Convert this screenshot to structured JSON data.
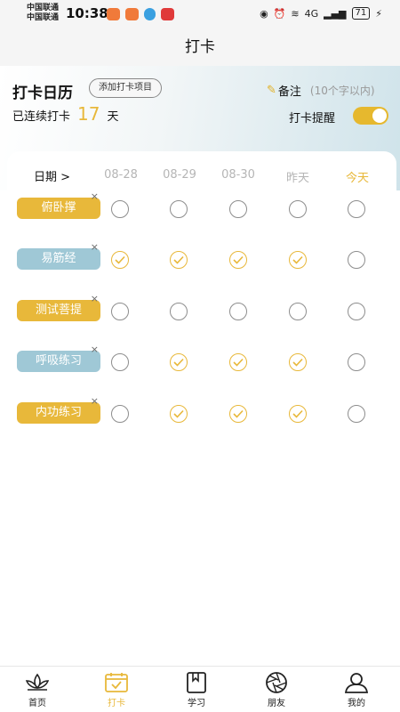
{
  "status": {
    "carrier1": "中国联通",
    "carrier2": "中国联通",
    "time": "10:38",
    "net": "4G",
    "battery": "71"
  },
  "title": "打卡",
  "header": {
    "calendar_title": "打卡日历",
    "add_button": "添加打卡项目",
    "note_label": "备注",
    "note_hint": "(10个字以内)",
    "streak_prefix": "已连续打卡",
    "streak_days": "17",
    "streak_suffix": "天",
    "reminder_label": "打卡提醒",
    "reminder_on": true
  },
  "dates": {
    "label": "日期 >",
    "columns": [
      "08-28",
      "08-29",
      "08-30",
      "昨天",
      "今天"
    ]
  },
  "habits": [
    {
      "name": "俯卧撑",
      "style": "gold",
      "checks": [
        false,
        false,
        false,
        false,
        false
      ]
    },
    {
      "name": "易筋经",
      "style": "blue",
      "checks": [
        true,
        true,
        true,
        true,
        false
      ]
    },
    {
      "name": "测试菩提",
      "style": "gold",
      "checks": [
        false,
        false,
        false,
        false,
        false
      ]
    },
    {
      "name": "呼吸练习",
      "style": "blue",
      "checks": [
        false,
        true,
        true,
        true,
        false
      ]
    },
    {
      "name": "内功练习",
      "style": "gold",
      "checks": [
        false,
        true,
        true,
        true,
        false
      ]
    }
  ],
  "nav": [
    {
      "label": "首页",
      "icon": "lotus-icon",
      "active": false
    },
    {
      "label": "打卡",
      "icon": "calendar-check-icon",
      "active": true
    },
    {
      "label": "学习",
      "icon": "book-icon",
      "active": false
    },
    {
      "label": "朋友",
      "icon": "aperture-icon",
      "active": false
    },
    {
      "label": "我的",
      "icon": "person-icon",
      "active": false
    }
  ],
  "colors": {
    "accent": "#e8b83a",
    "blue_pill": "#9fc8d6"
  }
}
